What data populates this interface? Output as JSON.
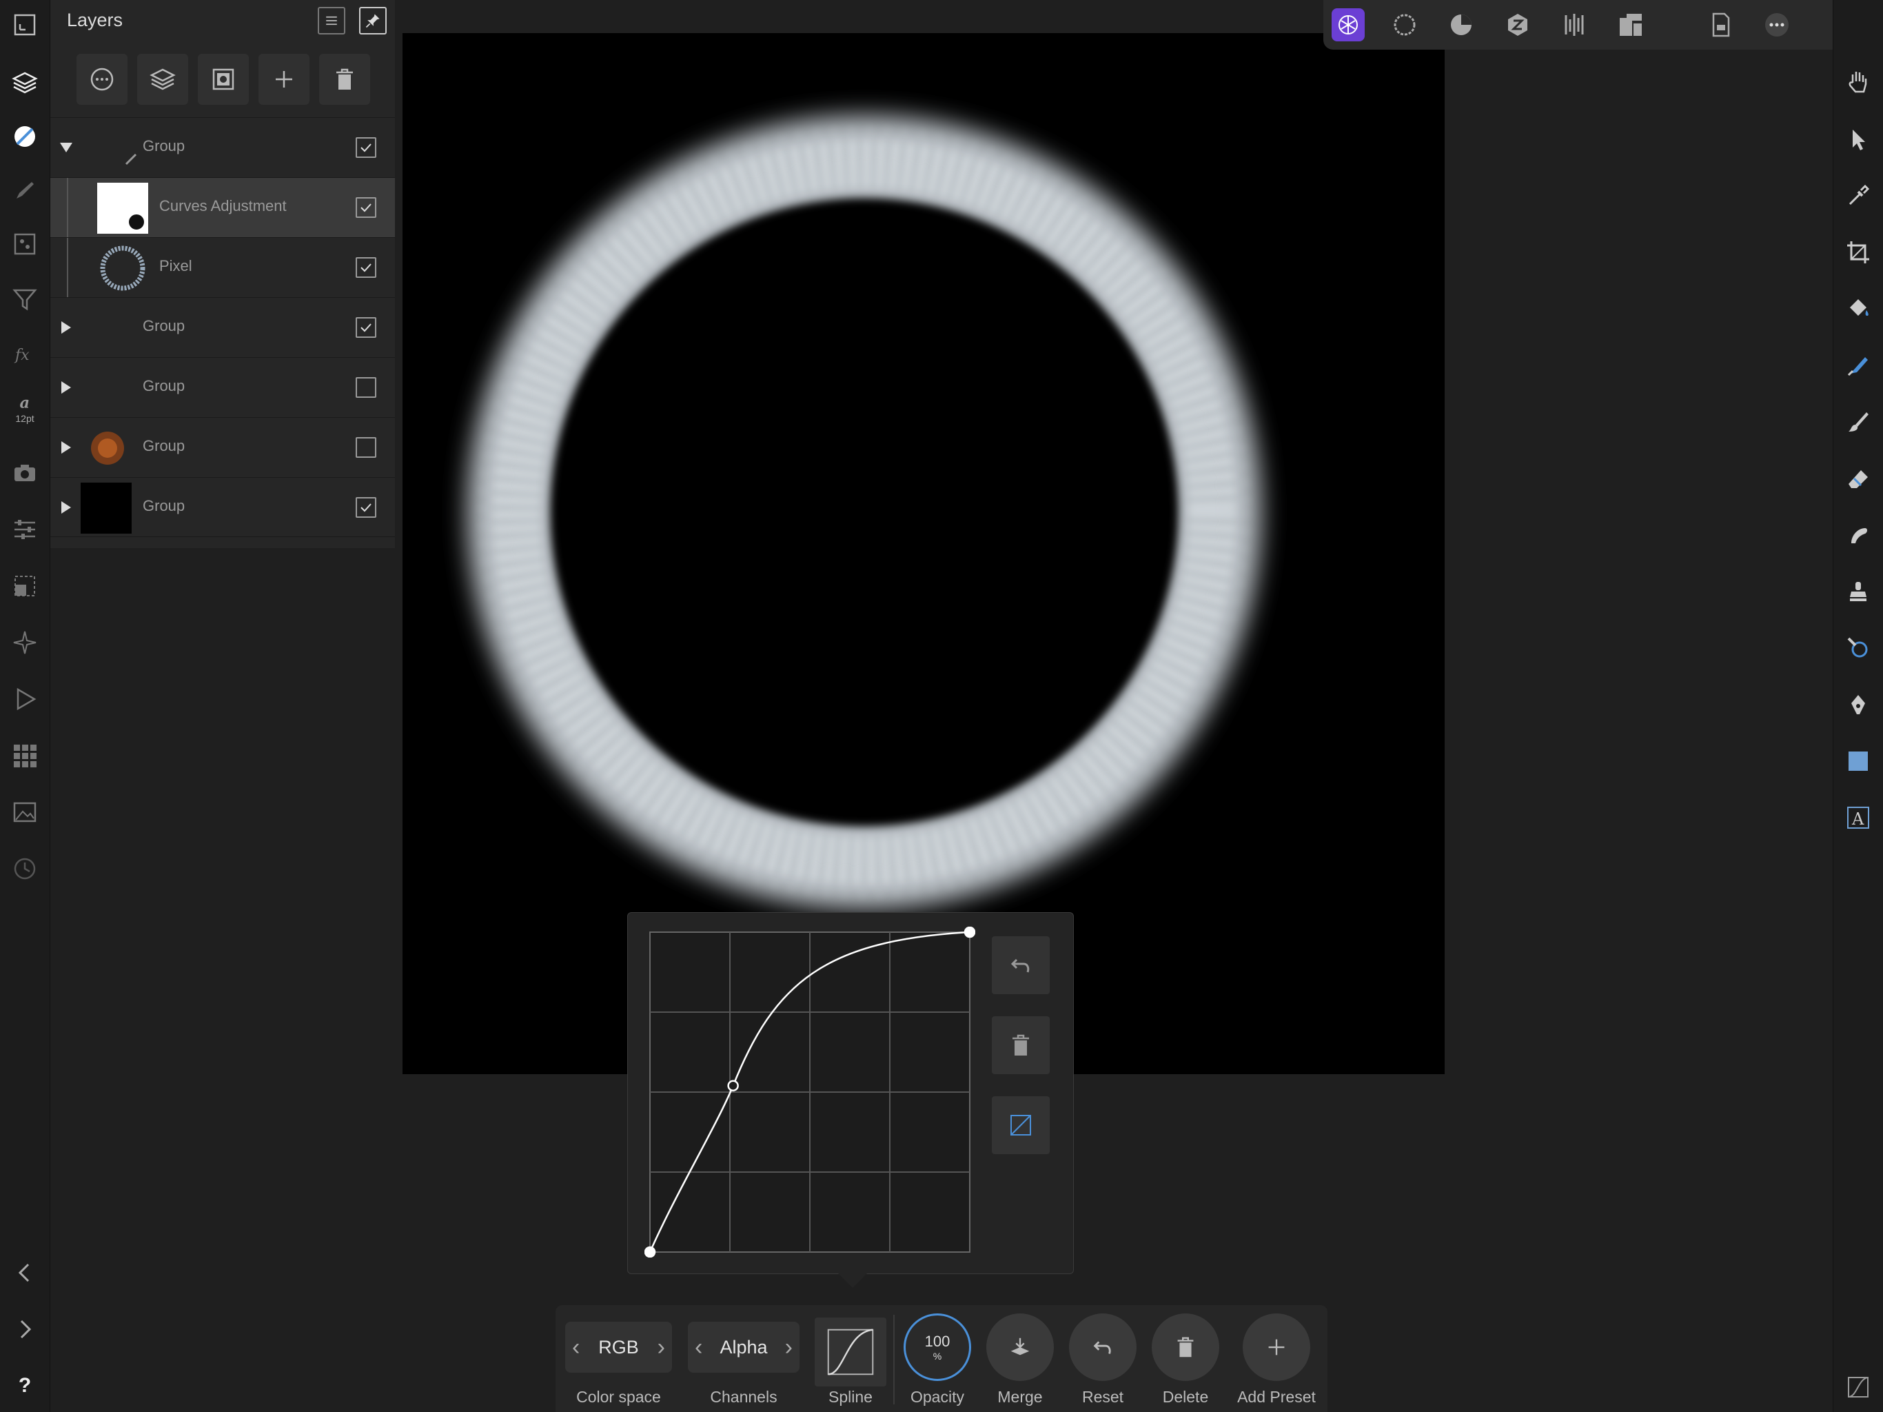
{
  "layers_panel": {
    "title": "Layers",
    "layers": [
      {
        "name": "Group",
        "expanded": true,
        "visible": true
      },
      {
        "name": "Curves Adjustment",
        "selected": true,
        "visible": true
      },
      {
        "name": "Pixel",
        "visible": true
      },
      {
        "name": "Group",
        "expanded": false,
        "visible": true
      },
      {
        "name": "Group",
        "expanded": false,
        "visible": false
      },
      {
        "name": "Group",
        "expanded": false,
        "visible": false
      },
      {
        "name": "Group",
        "expanded": false,
        "visible": true
      }
    ]
  },
  "left_rail": {
    "font_size_label": "12pt",
    "icons": [
      "view-mode-icon",
      "layers-icon",
      "adjustments-icon",
      "brush-icon",
      "channels-icon",
      "filter-icon",
      "fx-icon",
      "text-style-icon",
      "camera-icon",
      "sliders-icon",
      "transform-icon",
      "navigator-icon",
      "play-icon",
      "grid-icon",
      "image-icon",
      "history-icon",
      "chevron-left-icon",
      "chevron-right-icon"
    ],
    "help_label": "?"
  },
  "top_bar": {
    "personas": [
      "photo-persona-icon",
      "liquify-persona-icon",
      "develop-persona-icon",
      "tone-mapping-persona-icon",
      "export-persona-icon",
      "document-icon",
      "more-icon"
    ]
  },
  "right_tools": [
    "hand-tool-icon",
    "move-tool-icon",
    "eyedropper-tool-icon",
    "crop-tool-icon",
    "fill-tool-icon",
    "selection-brush-icon",
    "paint-brush-icon",
    "eraser-icon",
    "smudge-icon",
    "clone-stamp-icon",
    "dodge-burn-icon",
    "pen-tool-icon",
    "shape-tool-icon",
    "text-tool-icon",
    "curves-icon"
  ],
  "curves": {
    "points": [
      [
        0,
        0
      ],
      [
        0.26,
        0.52
      ],
      [
        1,
        1
      ]
    ],
    "color": "#ffffff"
  },
  "bottom_toolbar": {
    "color_space_value": "RGB",
    "color_space_label": "Color space",
    "channels_value": "Alpha",
    "channels_label": "Channels",
    "spline_label": "Spline",
    "opacity_value": "100",
    "opacity_unit": "%",
    "opacity_label": "Opacity",
    "merge_label": "Merge",
    "reset_label": "Reset",
    "delete_label": "Delete",
    "add_preset_label": "Add Preset",
    "accent": "#4a90d9"
  }
}
